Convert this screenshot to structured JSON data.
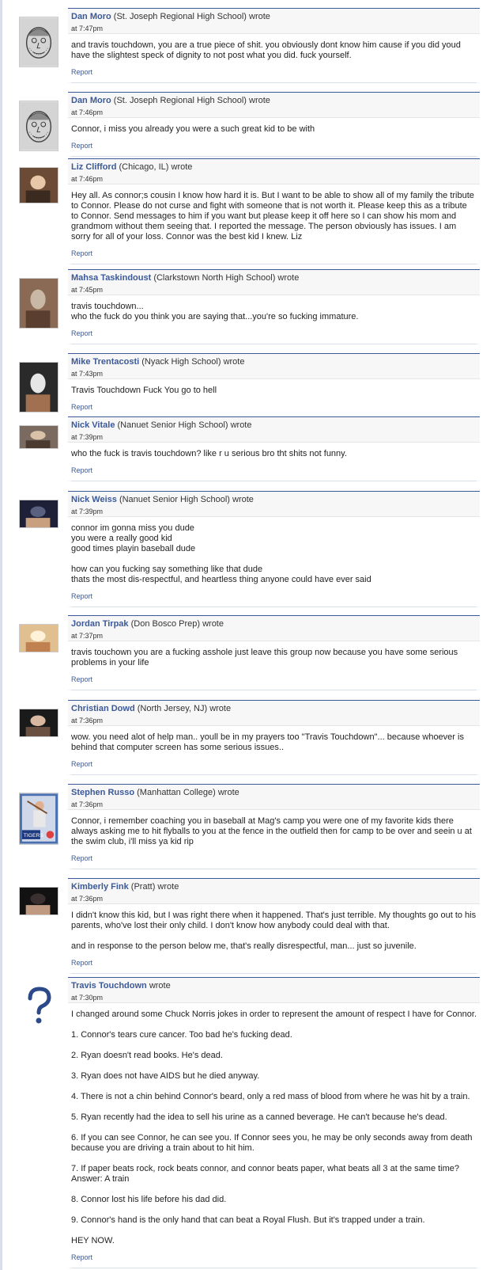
{
  "report_label": "Report",
  "posts": [
    {
      "author": "Dan Moro",
      "network": " (St. Joseph Regional High School) wrote",
      "time": "at 7:47pm",
      "body": "and travis touchdown, you are a true piece of shit. you obviously dont know him cause if you did youd have the slightest speck of dignity to not post what you did. fuck yourself.",
      "avatar": "drawn-face-icon"
    },
    {
      "author": "Dan Moro",
      "network": " (St. Joseph Regional High School) wrote",
      "time": "at 7:46pm",
      "body": "Connor, i miss you already you were a such great kid to be with",
      "avatar": "drawn-face-icon"
    },
    {
      "author": "Liz Clifford",
      "network": " (Chicago, IL) wrote",
      "time": "at 7:46pm",
      "body": "Hey all. As connor;s cousin I know how hard it is. But I want to be able to show all of my family the tribute to Connor. Please do not curse and fight with someone that is not worth it. Please keep this as a tribute to Connor. Send messages to him if you want but please keep it off here so I can show his mom and grandmom without them seeing that. I reported the message. The person obviously has issues. I am sorry for all of your loss. Connor was the best kid I knew. Liz",
      "avatar": "profile-photo"
    },
    {
      "author": "Mahsa Taskindoust",
      "network": " (Clarkstown North High School) wrote",
      "time": "at 7:45pm",
      "body": "travis touchdown...\nwho the fuck do you think you are saying that...you're so fucking immature.",
      "avatar": "profile-photo"
    },
    {
      "author": "Mike Trentacosti",
      "network": " (Nyack High School) wrote",
      "time": "at 7:43pm",
      "body": "Travis Touchdown Fuck You go to hell",
      "avatar": "profile-photo"
    },
    {
      "author": "Nick Vitale",
      "network": " (Nanuet Senior High School) wrote",
      "time": "at 7:39pm",
      "body": "who the fuck is travis touchdown? like r u serious bro tht shits not funny.",
      "avatar": "profile-photo"
    },
    {
      "author": "Nick Weiss",
      "network": " (Nanuet Senior High School) wrote",
      "time": "at 7:39pm",
      "body": "connor im gonna miss you dude\nyou were a really good kid\ngood times playin baseball dude\n\nhow can you fucking say something like that dude\nthats the most dis-respectful, and heartless thing anyone could have ever said",
      "avatar": "profile-photo"
    },
    {
      "author": "Jordan Tirpak",
      "network": " (Don Bosco Prep) wrote",
      "time": "at 7:37pm",
      "body": "travis touchown you are a fucking asshole just leave this group now because you have some serious problems in your life",
      "avatar": "profile-photo"
    },
    {
      "author": "Christian Dowd",
      "network": " (North Jersey, NJ) wrote",
      "time": "at 7:36pm",
      "body": "wow. you need alot of help man.. youll be in my prayers too \"Travis Touchdown\"... because whoever is behind that computer screen has some serious issues..",
      "avatar": "profile-photo"
    },
    {
      "author": "Stephen Russo",
      "network": " (Manhattan College) wrote",
      "time": "at 7:36pm",
      "body": "Connor, i remember coaching you in baseball at Mag's camp you were one of my favorite kids there always asking me to hit flyballs to you at the fence in the outfield then for camp to be over and seein u at the swim club, i'll miss ya kid rip",
      "avatar": "baseball-card",
      "card_text": "TIGERS"
    },
    {
      "author": "Kimberly Fink",
      "network": " (Pratt) wrote",
      "time": "at 7:36pm",
      "body": "I didn't know this kid, but I was right there when it happened. That's just terrible. My thoughts go out to his parents, who've lost their only child. I don't know how anybody could deal with that.\n\nand in response to the person below me, that's really disrespectful, man... just so juvenile.",
      "avatar": "profile-photo"
    },
    {
      "author": "Travis Touchdown",
      "network": " wrote",
      "time": "at 7:30pm",
      "body": "I changed around some Chuck Norris jokes in order to represent the amount of respect I have for Connor.\n\n1. Connor's tears cure cancer. Too bad he's fucking dead.\n\n2. Ryan doesn't read books. He's dead.\n\n3. Ryan does not have AIDS but he died anyway.\n\n4. There is not a chin behind Connor's beard, only a red mass of blood from where he was hit by a train.\n\n5. Ryan recently had the idea to sell his urine as a canned beverage. He can't because he's dead.\n\n6. If you can see Connor, he can see you. If Connor sees you, he may be only seconds away from death because you are driving a train about to hit him.\n\n7. If paper beats rock, rock beats connor, and connor beats paper, what beats all 3 at the same time? Answer: A train\n\n8. Connor lost his life before his dad did.\n\n9. Connor's hand is the only hand that can beat a Royal Flush. But it's trapped under a train.\n\nHEY NOW.",
      "avatar": "question-mark-icon"
    }
  ]
}
